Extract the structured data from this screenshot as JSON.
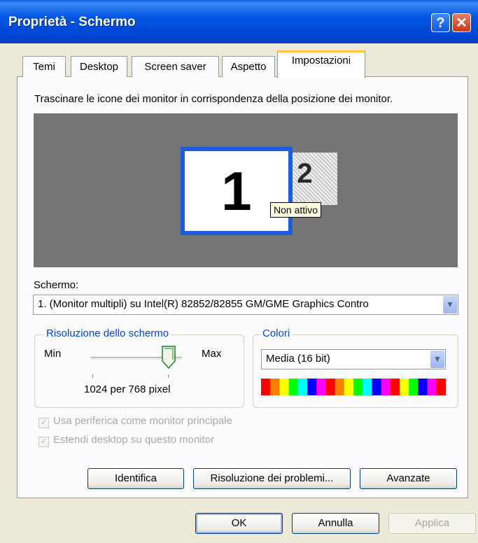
{
  "window": {
    "title": "Proprietà - Schermo",
    "help_glyph": "?",
    "close_glyph": "✕"
  },
  "tabs": [
    {
      "label": "Temi",
      "active": false
    },
    {
      "label": "Desktop",
      "active": false
    },
    {
      "label": "Screen saver",
      "active": false
    },
    {
      "label": "Aspetto",
      "active": false
    },
    {
      "label": "Impostazioni",
      "active": true
    }
  ],
  "instruction": "Trascinare le icone dei monitor in corrispondenza della posizione dei monitor.",
  "monitors": {
    "primary": "1",
    "secondary": "2",
    "tooltip": "Non attivo"
  },
  "screen": {
    "label": "Schermo:",
    "value": "1. (Monitor multipli) su Intel(R) 82852/82855 GM/GME Graphics Contro"
  },
  "resolution": {
    "legend": "Risoluzione dello schermo",
    "min": "Min",
    "max": "Max",
    "value": "1024 per 768 pixel",
    "slider_fraction": 0.85
  },
  "colors": {
    "legend": "Colori",
    "value": "Media (16 bit)",
    "palette": [
      "#ff0000",
      "#ff8000",
      "#ffff00",
      "#00ff00",
      "#00ffff",
      "#0000ff",
      "#ff00ff",
      "#ff0000",
      "#ff8000",
      "#ffff00",
      "#00ff00",
      "#00ffff",
      "#0000ff",
      "#ff00ff",
      "#ff0000",
      "#ffff00",
      "#00ff00",
      "#0000ff",
      "#ff00ff",
      "#ff0000"
    ]
  },
  "checkboxes": [
    {
      "label": "Usa periferica come monitor principale",
      "checked": true
    },
    {
      "label": "Estendi desktop su questo monitor",
      "checked": true
    }
  ],
  "buttons": {
    "identify": "Identifica",
    "troubleshoot": "Risoluzione dei problemi...",
    "advanced": "Avanzate",
    "ok": "OK",
    "cancel": "Annulla",
    "apply": "Applica"
  },
  "accent": "#0054e3"
}
